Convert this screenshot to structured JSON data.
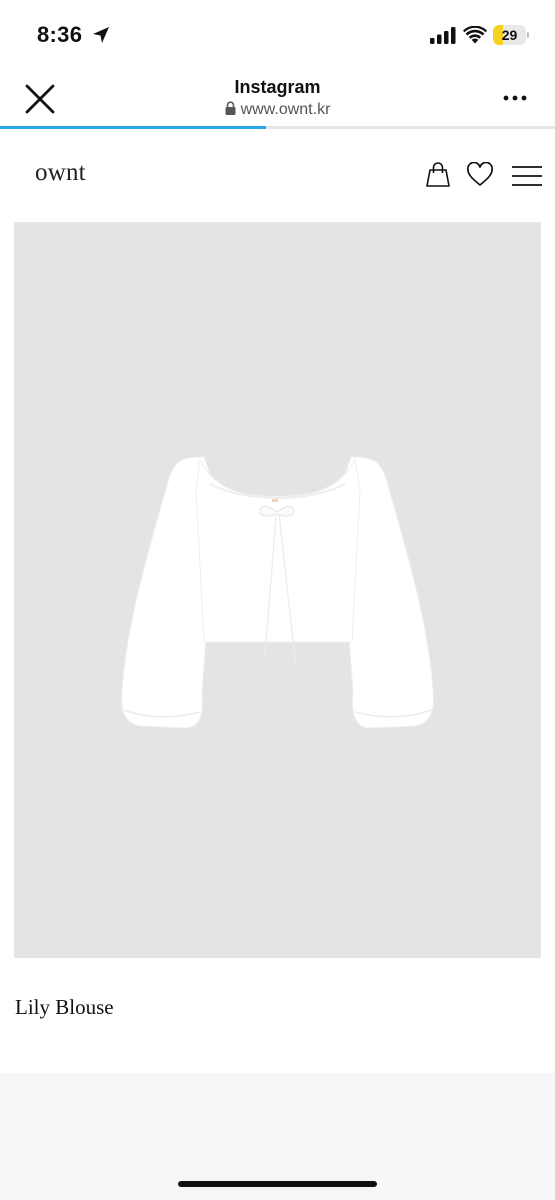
{
  "status_bar": {
    "time": "8:36",
    "location_icon": "location-arrow-icon",
    "signal_icon": "cellular-signal-icon",
    "wifi_icon": "wifi-icon",
    "battery_level": 29,
    "battery_text": "29",
    "battery_color": "#f7d21f"
  },
  "browser": {
    "title": "Instagram",
    "url": "www.ownt.kr",
    "close_icon": "close-icon",
    "lock_icon": "lock-icon",
    "more_icon": "more-dots-icon",
    "load_progress": 0.48,
    "progress_color": "#27a7e8"
  },
  "site": {
    "logo": "ownt",
    "bag_icon": "shopping-bag-icon",
    "heart_icon": "heart-icon",
    "menu_icon": "hamburger-menu-icon"
  },
  "product": {
    "name": "Lily Blouse",
    "image_background": "#e4e4e4"
  }
}
